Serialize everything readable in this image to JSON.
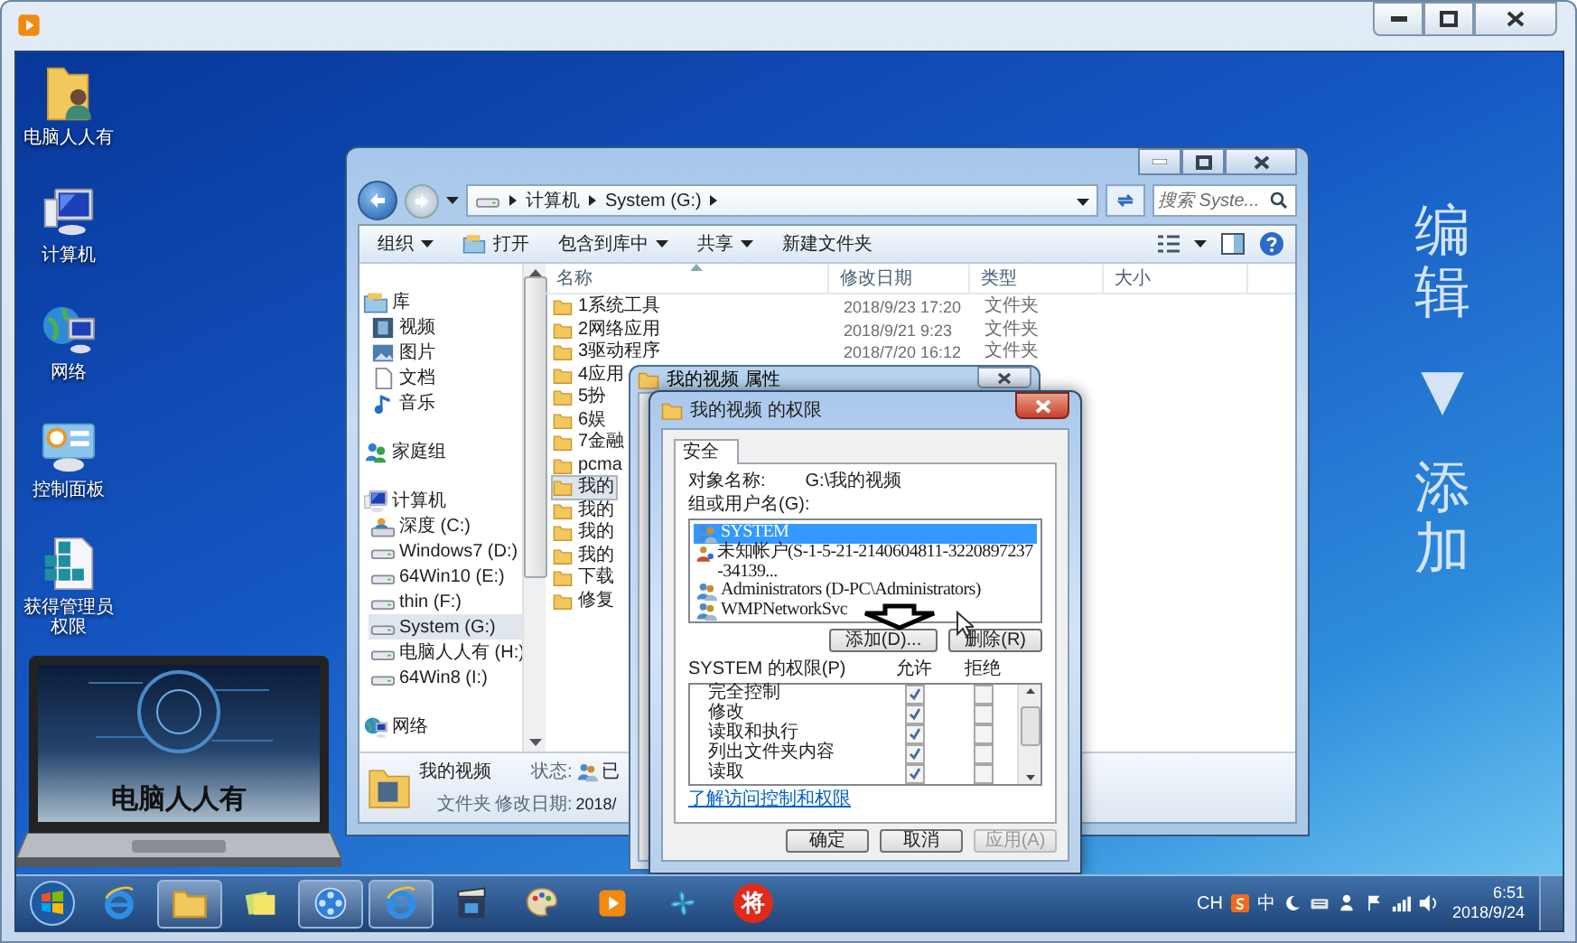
{
  "desktop_icons": [
    {
      "label": "电脑人人有",
      "kind": "userfolder"
    },
    {
      "label": "计算机",
      "kind": "computer"
    },
    {
      "label": "网络",
      "kind": "network"
    },
    {
      "label": "控制面板",
      "kind": "controlpanel"
    },
    {
      "label": "获得管理员权限",
      "kind": "cubes"
    }
  ],
  "laptop": {
    "screen_text": "电脑人人有"
  },
  "explorer": {
    "address": [
      "计算机",
      "System (G:)"
    ],
    "search_placeholder": "搜索 Syste...",
    "toolbar": [
      {
        "label": "组织",
        "dropdown": true,
        "kind": "plain"
      },
      {
        "label": "打开",
        "dropdown": false,
        "kind": "open"
      },
      {
        "label": "包含到库中",
        "dropdown": true,
        "kind": "plain"
      },
      {
        "label": "共享",
        "dropdown": true,
        "kind": "plain"
      },
      {
        "label": "新建文件夹",
        "dropdown": false,
        "kind": "plain"
      }
    ],
    "columns": [
      "名称",
      "修改日期",
      "类型",
      "大小"
    ],
    "sidebar": [
      {
        "label": "库",
        "kind": "library",
        "selected": false,
        "children": [
          {
            "label": "视频",
            "kind": "film",
            "selected": false
          },
          {
            "label": "图片",
            "kind": "picture",
            "selected": false
          },
          {
            "label": "文档",
            "kind": "document",
            "selected": false
          },
          {
            "label": "音乐",
            "kind": "music",
            "selected": false
          }
        ]
      },
      {
        "label": "家庭组",
        "kind": "homegroup",
        "selected": false
      },
      {
        "label": "计算机",
        "kind": "computer",
        "selected": false,
        "children": [
          {
            "label": "深度 (C:)",
            "kind": "sysdrive",
            "selected": false
          },
          {
            "label": "Windows7 (D:)",
            "kind": "drive",
            "selected": false
          },
          {
            "label": "64Win10 (E:)",
            "kind": "drive",
            "selected": false
          },
          {
            "label": "thin (F:)",
            "kind": "drive",
            "selected": false
          },
          {
            "label": "System (G:)",
            "kind": "drive",
            "selected": true
          },
          {
            "label": "电脑人人有 (H:)",
            "kind": "drive",
            "selected": false
          },
          {
            "label": "64Win8  (I:)",
            "kind": "drive",
            "selected": false
          }
        ]
      },
      {
        "label": "网络",
        "kind": "network",
        "selected": false
      }
    ],
    "files": [
      {
        "name": "1系统工具",
        "modified": "2018/9/23 17:20",
        "type": "文件夹",
        "selected": false
      },
      {
        "name": "2网络应用",
        "modified": "2018/9/21 9:23",
        "type": "文件夹",
        "selected": false
      },
      {
        "name": "3驱动程序",
        "modified": "2018/7/20 16:12",
        "type": "文件夹",
        "selected": false
      },
      {
        "name": "4应用",
        "selected": false
      },
      {
        "name": "5扮",
        "selected": false
      },
      {
        "name": "6娱",
        "selected": false
      },
      {
        "name": "7金融",
        "selected": false
      },
      {
        "name": "pcma",
        "selected": false
      },
      {
        "name": "我的",
        "selected": true
      },
      {
        "name": "我的",
        "selected": false
      },
      {
        "name": "我的",
        "selected": false
      },
      {
        "name": "我的",
        "selected": false
      },
      {
        "name": "下载",
        "selected": false
      },
      {
        "name": "修复",
        "selected": false
      }
    ],
    "details": {
      "name": "我的视频",
      "type": "文件夹",
      "status_label": "状态:",
      "status_value": "已",
      "modified_label": "修改日期:",
      "modified_value": "2018/"
    }
  },
  "properties_dialog": {
    "title": "我的视频 属性"
  },
  "permissions_dialog": {
    "title": "我的视频 的权限",
    "tabs": [
      {
        "label": "安全",
        "selected": true
      }
    ],
    "object_label": "对象名称:",
    "object_value": "G:\\我的视频",
    "users_label": "组或用户名(G):",
    "users": [
      {
        "name": "SYSTEM",
        "kind": "group",
        "selected": true
      },
      {
        "name": "未知帐户(S-1-5-21-2140604811-3220897237-34139...",
        "kind": "unknown",
        "selected": false
      },
      {
        "name": "Administrators (D-PC\\Administrators)",
        "kind": "group",
        "selected": false
      },
      {
        "name": "WMPNetworkSvc",
        "kind": "group",
        "selected": false
      }
    ],
    "add_button": "添加(D)...",
    "remove_button": "删除(R)",
    "permissions_label": "SYSTEM 的权限(P)",
    "allow_header": "允许",
    "deny_header": "拒绝",
    "permissions": [
      {
        "name": "完全控制",
        "allow": true,
        "deny": false
      },
      {
        "name": "修改",
        "allow": true,
        "deny": false
      },
      {
        "name": "读取和执行",
        "allow": true,
        "deny": false
      },
      {
        "name": "列出文件夹内容",
        "allow": true,
        "deny": false
      },
      {
        "name": "读取",
        "allow": true,
        "deny": false
      }
    ],
    "link": "了解访问控制和权限",
    "buttons": [
      {
        "label": "确定",
        "disabled": false
      },
      {
        "label": "取消",
        "disabled": false
      },
      {
        "label": "应用(A)",
        "disabled": true
      }
    ]
  },
  "annotation": [
    "编辑",
    "▼",
    "添加"
  ],
  "taskbar": {
    "apps": [
      {
        "kind": "ie",
        "running": false
      },
      {
        "kind": "folder",
        "running": true
      },
      {
        "kind": "notes",
        "running": false
      },
      {
        "kind": "media",
        "running": true
      },
      {
        "kind": "ie",
        "running": true
      },
      {
        "kind": "clapper",
        "running": false
      },
      {
        "kind": "palette",
        "running": false
      },
      {
        "kind": "player",
        "running": false
      },
      {
        "kind": "pinwheel",
        "running": false
      },
      {
        "kind": "badge",
        "label": "将",
        "running": false
      }
    ],
    "tray": [
      {
        "kind": "language",
        "label": "CH"
      },
      {
        "kind": "slogo"
      },
      {
        "kind": "inputmode",
        "label": "中"
      },
      {
        "kind": "moon"
      },
      {
        "kind": "keyboard"
      },
      {
        "kind": "person"
      },
      {
        "kind": "flag"
      },
      {
        "kind": "signal"
      },
      {
        "kind": "speaker"
      }
    ],
    "time": "6:51",
    "date": "2018/9/24"
  }
}
